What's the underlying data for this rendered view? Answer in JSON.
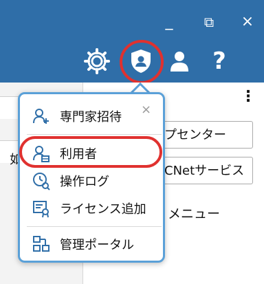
{
  "window": {
    "minimize_glyph": "_",
    "restore_glyph": "⧉",
    "close_glyph": "×"
  },
  "toolbar": {
    "icons": [
      "gear-icon",
      "admin-shield-icon",
      "user-icon",
      "help-icon"
    ],
    "help_glyph": "?"
  },
  "background": {
    "right_buttons": [
      "プセンター",
      "CNetサービス"
    ],
    "menu_text": "メニュー",
    "more_glyph": "⋮",
    "left_fragment": "如"
  },
  "popup": {
    "items": [
      {
        "label": "専門家招待",
        "icon": "invite-user-icon"
      },
      {
        "label": "利用者",
        "icon": "users-icon"
      },
      {
        "label": "操作ログ",
        "icon": "history-log-icon"
      },
      {
        "label": "ライセンス追加",
        "icon": "license-add-icon"
      },
      {
        "label": "管理ポータル",
        "icon": "portal-network-icon"
      }
    ],
    "close_glyph": "×"
  },
  "colors": {
    "header_blue": "#2f6ea8",
    "popup_border": "#5aa0d8",
    "highlight_red": "#e0312f"
  }
}
